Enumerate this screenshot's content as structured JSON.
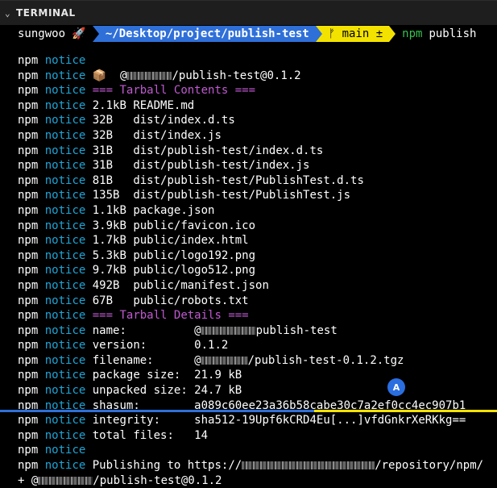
{
  "panel": {
    "title": "TERMINAL",
    "chevron": "⌄"
  },
  "prompt": {
    "user": "sungwoo 🚀",
    "path": "~/Desktop/project/publish-test",
    "git": "ᚠ main ±",
    "command": "npm",
    "arg": "publish"
  },
  "lines": [
    {
      "npm": "npm",
      "notice": "notice",
      "text": "",
      "type": "plain"
    },
    {
      "npm": "npm",
      "notice": "notice",
      "text": "📦  @",
      "tail": "/publish-test@0.1.2",
      "type": "blur",
      "blur": 56
    },
    {
      "npm": "npm",
      "notice": "notice",
      "text": "=== Tarball Contents ===",
      "type": "magenta"
    },
    {
      "npm": "npm",
      "notice": "notice",
      "text": "2.1kB README.md",
      "type": "plain"
    },
    {
      "npm": "npm",
      "notice": "notice",
      "text": "32B   dist/index.d.ts",
      "type": "plain"
    },
    {
      "npm": "npm",
      "notice": "notice",
      "text": "32B   dist/index.js",
      "type": "plain"
    },
    {
      "npm": "npm",
      "notice": "notice",
      "text": "31B   dist/publish-test/index.d.ts",
      "type": "plain"
    },
    {
      "npm": "npm",
      "notice": "notice",
      "text": "31B   dist/publish-test/index.js",
      "type": "plain"
    },
    {
      "npm": "npm",
      "notice": "notice",
      "text": "81B   dist/publish-test/PublishTest.d.ts",
      "type": "plain"
    },
    {
      "npm": "npm",
      "notice": "notice",
      "text": "135B  dist/publish-test/PublishTest.js",
      "type": "plain"
    },
    {
      "npm": "npm",
      "notice": "notice",
      "text": "1.1kB package.json",
      "type": "plain"
    },
    {
      "npm": "npm",
      "notice": "notice",
      "text": "3.9kB public/favicon.ico",
      "type": "plain"
    },
    {
      "npm": "npm",
      "notice": "notice",
      "text": "1.7kB public/index.html",
      "type": "plain"
    },
    {
      "npm": "npm",
      "notice": "notice",
      "text": "5.3kB public/logo192.png",
      "type": "plain"
    },
    {
      "npm": "npm",
      "notice": "notice",
      "text": "9.7kB public/logo512.png",
      "type": "plain"
    },
    {
      "npm": "npm",
      "notice": "notice",
      "text": "492B  public/manifest.json",
      "type": "plain"
    },
    {
      "npm": "npm",
      "notice": "notice",
      "text": "67B   public/robots.txt",
      "type": "plain"
    },
    {
      "npm": "npm",
      "notice": "notice",
      "text": "=== Tarball Details ===",
      "type": "magenta"
    },
    {
      "npm": "npm",
      "notice": "notice",
      "text": "name:          @",
      "tail": "publish-test",
      "type": "blur",
      "blur": 68
    },
    {
      "npm": "npm",
      "notice": "notice",
      "text": "version:       0.1.2",
      "type": "plain"
    },
    {
      "npm": "npm",
      "notice": "notice",
      "text": "filename:      @",
      "tail": "/publish-test-0.1.2.tgz",
      "type": "blur",
      "blur": 58
    },
    {
      "npm": "npm",
      "notice": "notice",
      "text": "package size:  21.9 kB",
      "type": "plain"
    },
    {
      "npm": "npm",
      "notice": "notice",
      "text": "unpacked size: 24.7 kB",
      "type": "plain"
    },
    {
      "npm": "npm",
      "notice": "notice",
      "text": "shasum:        a089c60ee23a36b58cabe30c7a2ef0cc4ec907b1",
      "type": "plain"
    },
    {
      "npm": "npm",
      "notice": "notice",
      "text": "integrity:     sha512-19Upf6kCRD4Eu[...]vfdGnkrXeRKkg==",
      "type": "plain"
    },
    {
      "npm": "npm",
      "notice": "notice",
      "text": "total files:   14",
      "type": "plain"
    },
    {
      "npm": "npm",
      "notice": "notice",
      "text": "",
      "type": "plain"
    },
    {
      "npm": "npm",
      "notice": "notice",
      "text": "Publishing to https://",
      "tail": "/repository/npm/",
      "type": "blur",
      "blur": 165
    },
    {
      "npm": "",
      "notice": "",
      "text": "+ @",
      "tail": "/publish-test@0.1.2",
      "type": "blur",
      "blur": 68
    }
  ],
  "badge": {
    "letter": "A",
    "color": "#2a6ee0"
  },
  "colors": {
    "notice": "#1ea5d6",
    "section": "#c05ad1",
    "path_bg": "#2f6fd8",
    "git_bg": "#f3e200"
  }
}
